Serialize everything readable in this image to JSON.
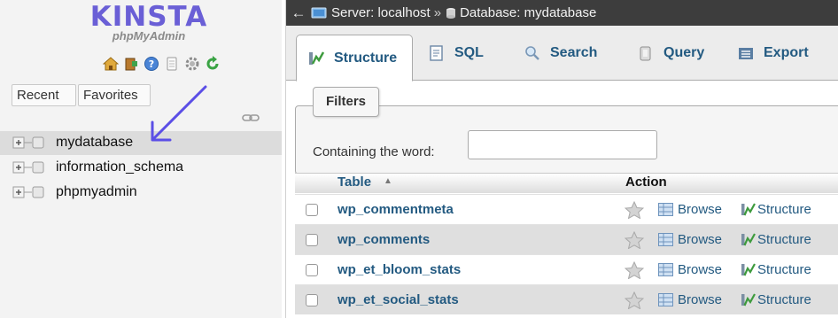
{
  "nav": {
    "logo": "KINSTA",
    "subtitle": "phpMyAdmin",
    "quick_icons": [
      "home-icon",
      "exit-icon",
      "help-icon",
      "docs-icon",
      "settings-icon",
      "reload-icon"
    ],
    "tabs": {
      "recent": "Recent",
      "favorites": "Favorites"
    },
    "databases": [
      "mydatabase",
      "information_schema",
      "phpmyadmin"
    ],
    "selected_database": "mydatabase"
  },
  "breadcrumb": {
    "back": "←",
    "server": "Server: localhost",
    "separator": "»",
    "database": "Database: mydatabase"
  },
  "tabs": {
    "structure": "Structure",
    "sql": "SQL",
    "search": "Search",
    "query": "Query",
    "export": "Export",
    "active": "Structure"
  },
  "filters": {
    "legend": "Filters",
    "label": "Containing the word:",
    "value": ""
  },
  "table": {
    "headers": {
      "table": "Table",
      "sort_indicator": "▲",
      "action": "Action"
    },
    "rows": [
      {
        "name": "wp_commentmeta",
        "browse": "Browse",
        "structure": "Structure"
      },
      {
        "name": "wp_comments",
        "browse": "Browse",
        "structure": "Structure"
      },
      {
        "name": "wp_et_bloom_stats",
        "browse": "Browse",
        "structure": "Structure"
      },
      {
        "name": "wp_et_social_stats",
        "browse": "Browse",
        "structure": "Structure"
      }
    ]
  },
  "colors": {
    "brand": "#6a5fd6",
    "link": "#235a81",
    "annotation_arrow": "#5b4ee6",
    "topbar": "#3d3d3d",
    "nav_bg": "#f3f3f3"
  }
}
